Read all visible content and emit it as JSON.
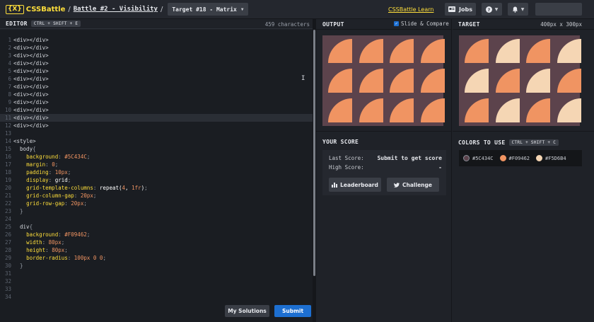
{
  "header": {
    "logo_mark": "{X}",
    "logo_text": "CSSBattle",
    "sep1": "/",
    "battle_link": "Battle #2 - Visibility",
    "sep2": "/",
    "target_selector": "Target #18 - Matrix",
    "learn_link": "CSSBattle Learn",
    "jobs_label": "Jobs",
    "help_icon": "question-circle-icon",
    "bell_icon": "bell-icon",
    "user_placeholder": ""
  },
  "editor": {
    "title": "EDITOR",
    "shortcut": "CTRL + SHIFT + E",
    "char_count": "459 characters",
    "lines": [
      "<div></div>",
      "<div></div>",
      "<div></div>",
      "<div></div>",
      "<div></div>",
      "<div></div>",
      "<div></div>",
      "<div></div>",
      "<div></div>",
      "<div></div>",
      "<div></div>",
      "<div></div>",
      "",
      "<style>",
      "  body{",
      "    background: #5C434C;",
      "    margin: 0;",
      "    padding: 10px;",
      "    display: grid;",
      "    grid-template-columns: repeat(4, 1fr);",
      "    grid-column-gap: 20px;",
      "    grid-row-gap: 20px;",
      "  }",
      "",
      "  div{",
      "    background: #F09462;",
      "    width: 80px;",
      "    height: 80px;",
      "    border-radius: 100px 0 0;",
      "  }",
      "",
      "",
      "",
      ""
    ],
    "active_line": 11,
    "my_solutions_label": "My Solutions",
    "submit_label": "Submit"
  },
  "output": {
    "title": "OUTPUT",
    "slide_compare_label": "Slide & Compare",
    "slide_compare_checked": true,
    "background_color": "#5C434C",
    "tile_colors": [
      "#F09462",
      "#F09462",
      "#F09462",
      "#F09462",
      "#F09462",
      "#F09462",
      "#F09462",
      "#F09462",
      "#F09462",
      "#F09462",
      "#F09462",
      "#F09462"
    ]
  },
  "score": {
    "title": "YOUR SCORE",
    "last_score_label": "Last Score:",
    "last_score_value": "Submit to get score",
    "high_score_label": "High Score:",
    "high_score_value": "-",
    "leaderboard_label": "Leaderboard",
    "challenge_label": "Challenge"
  },
  "target": {
    "title": "TARGET",
    "size": "400px x 300px",
    "background_color": "#5C434C",
    "tile_colors": [
      "#F09462",
      "#F5D6B4",
      "#F09462",
      "#F5D6B4",
      "#F5D6B4",
      "#F09462",
      "#F5D6B4",
      "#F09462",
      "#F09462",
      "#F5D6B4",
      "#F09462",
      "#F5D6B4"
    ]
  },
  "colors_to_use": {
    "title": "COLORS TO USE",
    "shortcut": "CTRL + SHIFT + C",
    "colors": [
      "#5C434C",
      "#F09462",
      "#F5D6B4"
    ]
  }
}
